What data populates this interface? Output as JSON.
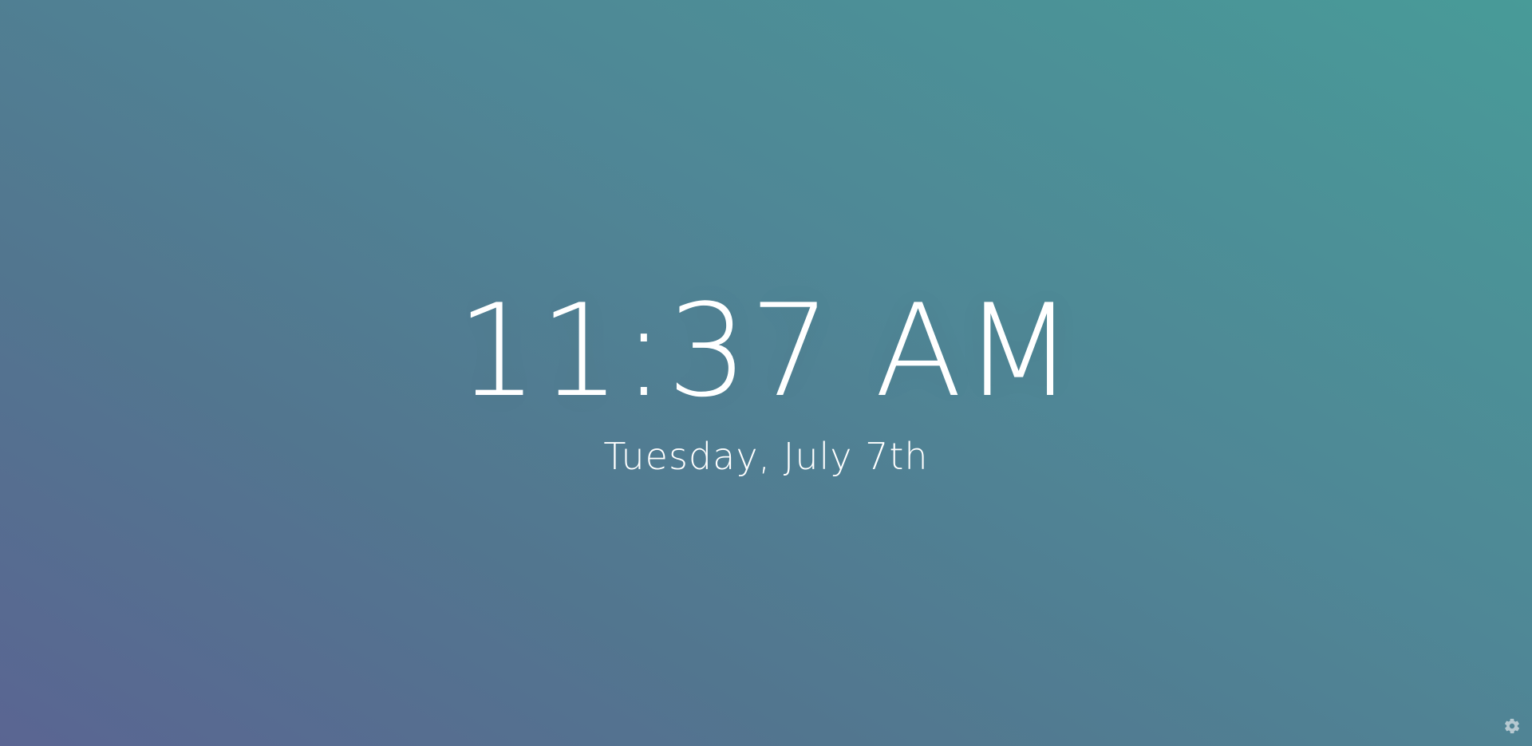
{
  "clock": {
    "time": "11:37 AM",
    "date": "Tuesday, July 7th"
  },
  "settings": {
    "icon": "gear-icon"
  },
  "colors": {
    "gradient_start": "#5a6592",
    "gradient_end": "#489b98",
    "text": "#ffffff"
  }
}
